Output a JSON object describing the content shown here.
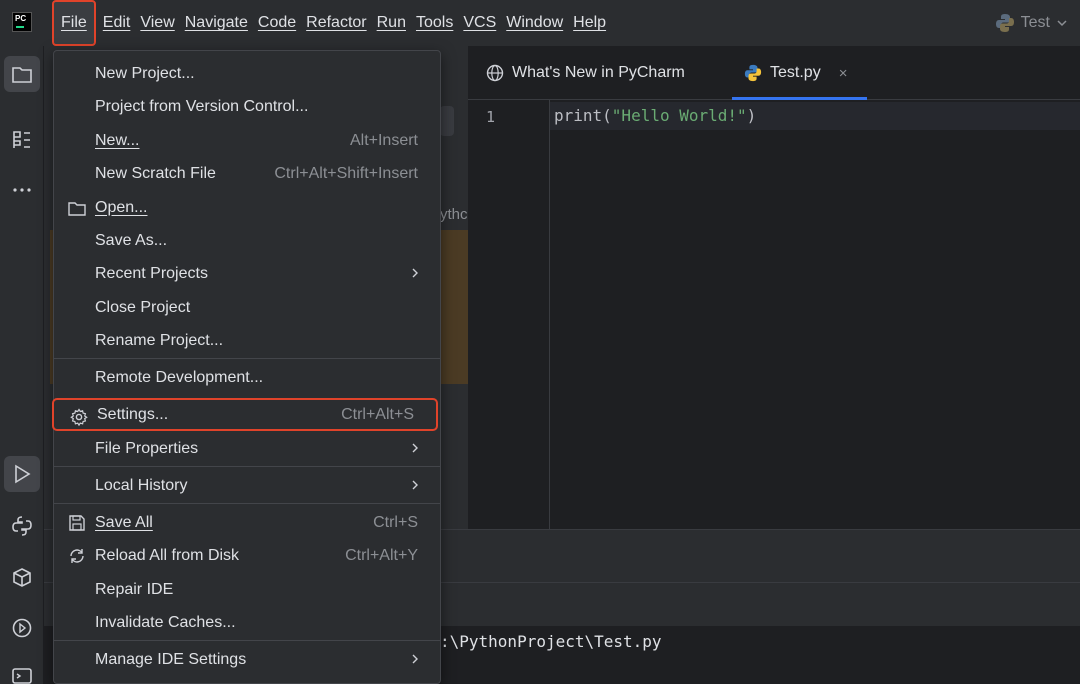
{
  "titlebar": {
    "logo_text": "PC",
    "project_name": "Test",
    "menu": [
      {
        "label": "File"
      },
      {
        "label": "Edit"
      },
      {
        "label": "View"
      },
      {
        "label": "Navigate"
      },
      {
        "label": "Code"
      },
      {
        "label": "Refactor"
      },
      {
        "label": "Run"
      },
      {
        "label": "Tools"
      },
      {
        "label": "VCS"
      },
      {
        "label": "Window"
      },
      {
        "label": "Help"
      }
    ]
  },
  "project_panel": {
    "partial_text": "ythc"
  },
  "tabs": [
    {
      "label": "What's New in PyCharm",
      "icon": "globe-icon"
    },
    {
      "label": "Test.py",
      "icon": "python-icon",
      "close": "×"
    }
  ],
  "editor": {
    "line_number": "1",
    "code_prefix": "print(",
    "code_string": "\"Hello World!\"",
    "code_suffix": ")"
  },
  "console": {
    "text": ":\\PythonProject\\Test.py"
  },
  "file_menu": {
    "items": [
      {
        "label": "New Project...",
        "shortcut": ""
      },
      {
        "label": "Project from Version Control...",
        "shortcut": ""
      },
      {
        "label": "New...",
        "shortcut": "Alt+Insert"
      },
      {
        "label": "New Scratch File",
        "shortcut": "Ctrl+Alt+Shift+Insert"
      },
      {
        "label": "Open...",
        "shortcut": "",
        "icon": "folder-icon"
      },
      {
        "label": "Save As...",
        "shortcut": ""
      },
      {
        "label": "Recent Projects",
        "shortcut": "",
        "submenu": true
      },
      {
        "label": "Close Project",
        "shortcut": ""
      },
      {
        "label": "Rename Project...",
        "shortcut": ""
      },
      {
        "label": "Remote Development...",
        "shortcut": ""
      },
      {
        "label": "Settings...",
        "shortcut": "Ctrl+Alt+S",
        "icon": "gear-icon"
      },
      {
        "label": "File Properties",
        "shortcut": "",
        "submenu": true
      },
      {
        "label": "Local History",
        "shortcut": "",
        "submenu": true
      },
      {
        "label": "Save All",
        "shortcut": "Ctrl+S",
        "icon": "save-icon"
      },
      {
        "label": "Reload All from Disk",
        "shortcut": "Ctrl+Alt+Y",
        "icon": "reload-icon"
      },
      {
        "label": "Repair IDE",
        "shortcut": ""
      },
      {
        "label": "Invalidate Caches...",
        "shortcut": ""
      },
      {
        "label": "Manage IDE Settings",
        "shortcut": "",
        "submenu": true
      }
    ]
  },
  "colors": {
    "highlight": "#e0432a",
    "accent": "#3574f0",
    "string": "#6aab73"
  }
}
